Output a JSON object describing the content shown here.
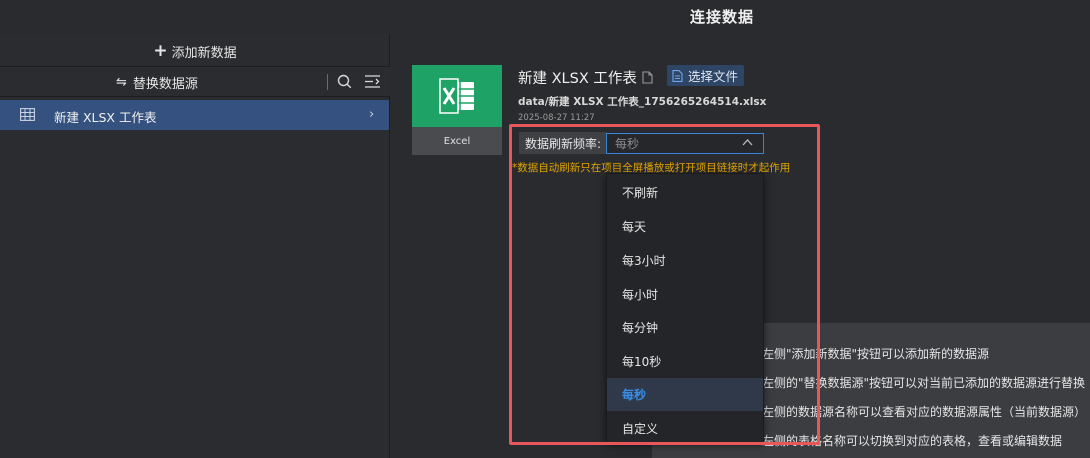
{
  "header": {
    "title": "连接数据"
  },
  "left_panel": {
    "add_label": "添加新数据",
    "replace_label": "替换数据源",
    "items": [
      {
        "label": "新建 XLSX 工作表",
        "selected": true
      }
    ]
  },
  "file": {
    "type_label": "Excel",
    "title": "新建 XLSX 工作表",
    "choose_label": "选择文件",
    "path": "data/新建 XLSX 工作表_1756265264514.xlsx",
    "date": "2025-08-27 11:27"
  },
  "refresh": {
    "label": "数据刷新频率:",
    "selected": "每秒",
    "tip": "*数据自动刷新只在项目全屏播放或打开项目链接时才起作用",
    "options": [
      "不刷新",
      "每天",
      "每3小时",
      "每小时",
      "每分钟",
      "每10秒",
      "每秒",
      "自定义"
    ],
    "selected_index": 6
  },
  "help": {
    "lines": [
      "左侧\"添加新数据\"按钮可以添加新的数据源",
      "左侧的\"替换数据源\"按钮可以对当前已添加的数据源进行替换",
      "左侧的数据源名称可以查看对应的数据源属性（当前数据源）",
      "左侧的表格名称可以切换到对应的表格，查看或编辑数据"
    ]
  },
  "colors": {
    "accent": "#3a8ee6",
    "excel_green": "#1fa265",
    "highlight": "#e8585b",
    "warning": "#e2a400"
  }
}
